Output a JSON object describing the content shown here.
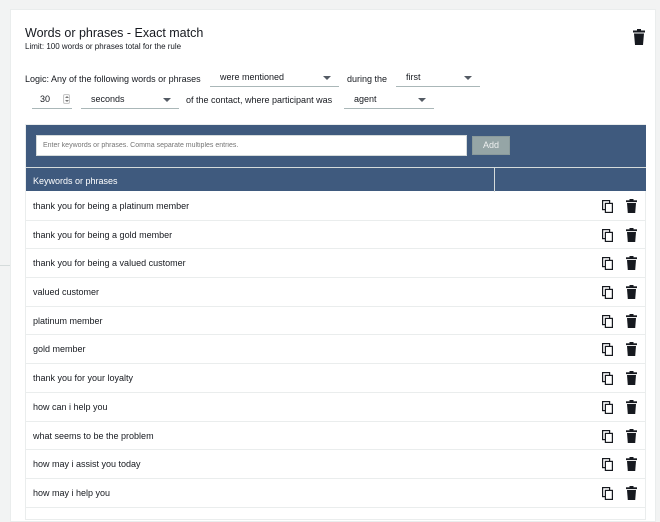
{
  "rule": {
    "title": "Words or phrases - Exact match",
    "subtitle": "Limit: 100 words or phrases total for the rule",
    "delete_icon": "trash-icon"
  },
  "logic": {
    "prefix": "Logic: Any of the following words or phrases",
    "condition": "were mentioned",
    "during_label": "during the",
    "position": "first",
    "duration_value": "30",
    "duration_unit": "seconds",
    "contact_label": "of the contact, where participant was",
    "participant": "agent"
  },
  "keywords": {
    "input_placeholder": "Enter keywords or phrases. Comma separate multiples entries.",
    "add_label": "Add",
    "column_header": "Keywords or phrases",
    "header_color": "#3f5a7e",
    "rows": [
      "thank you for being a platinum member",
      "thank you for being a gold member",
      "thank you for being a valued customer",
      "valued customer",
      "platinum member",
      "gold member",
      "thank you for your loyalty",
      "how can i help you",
      "what seems to be the problem",
      "how may i assist you today",
      "how may i help you"
    ],
    "row_icons": [
      "copy-icon",
      "trash-icon"
    ]
  }
}
